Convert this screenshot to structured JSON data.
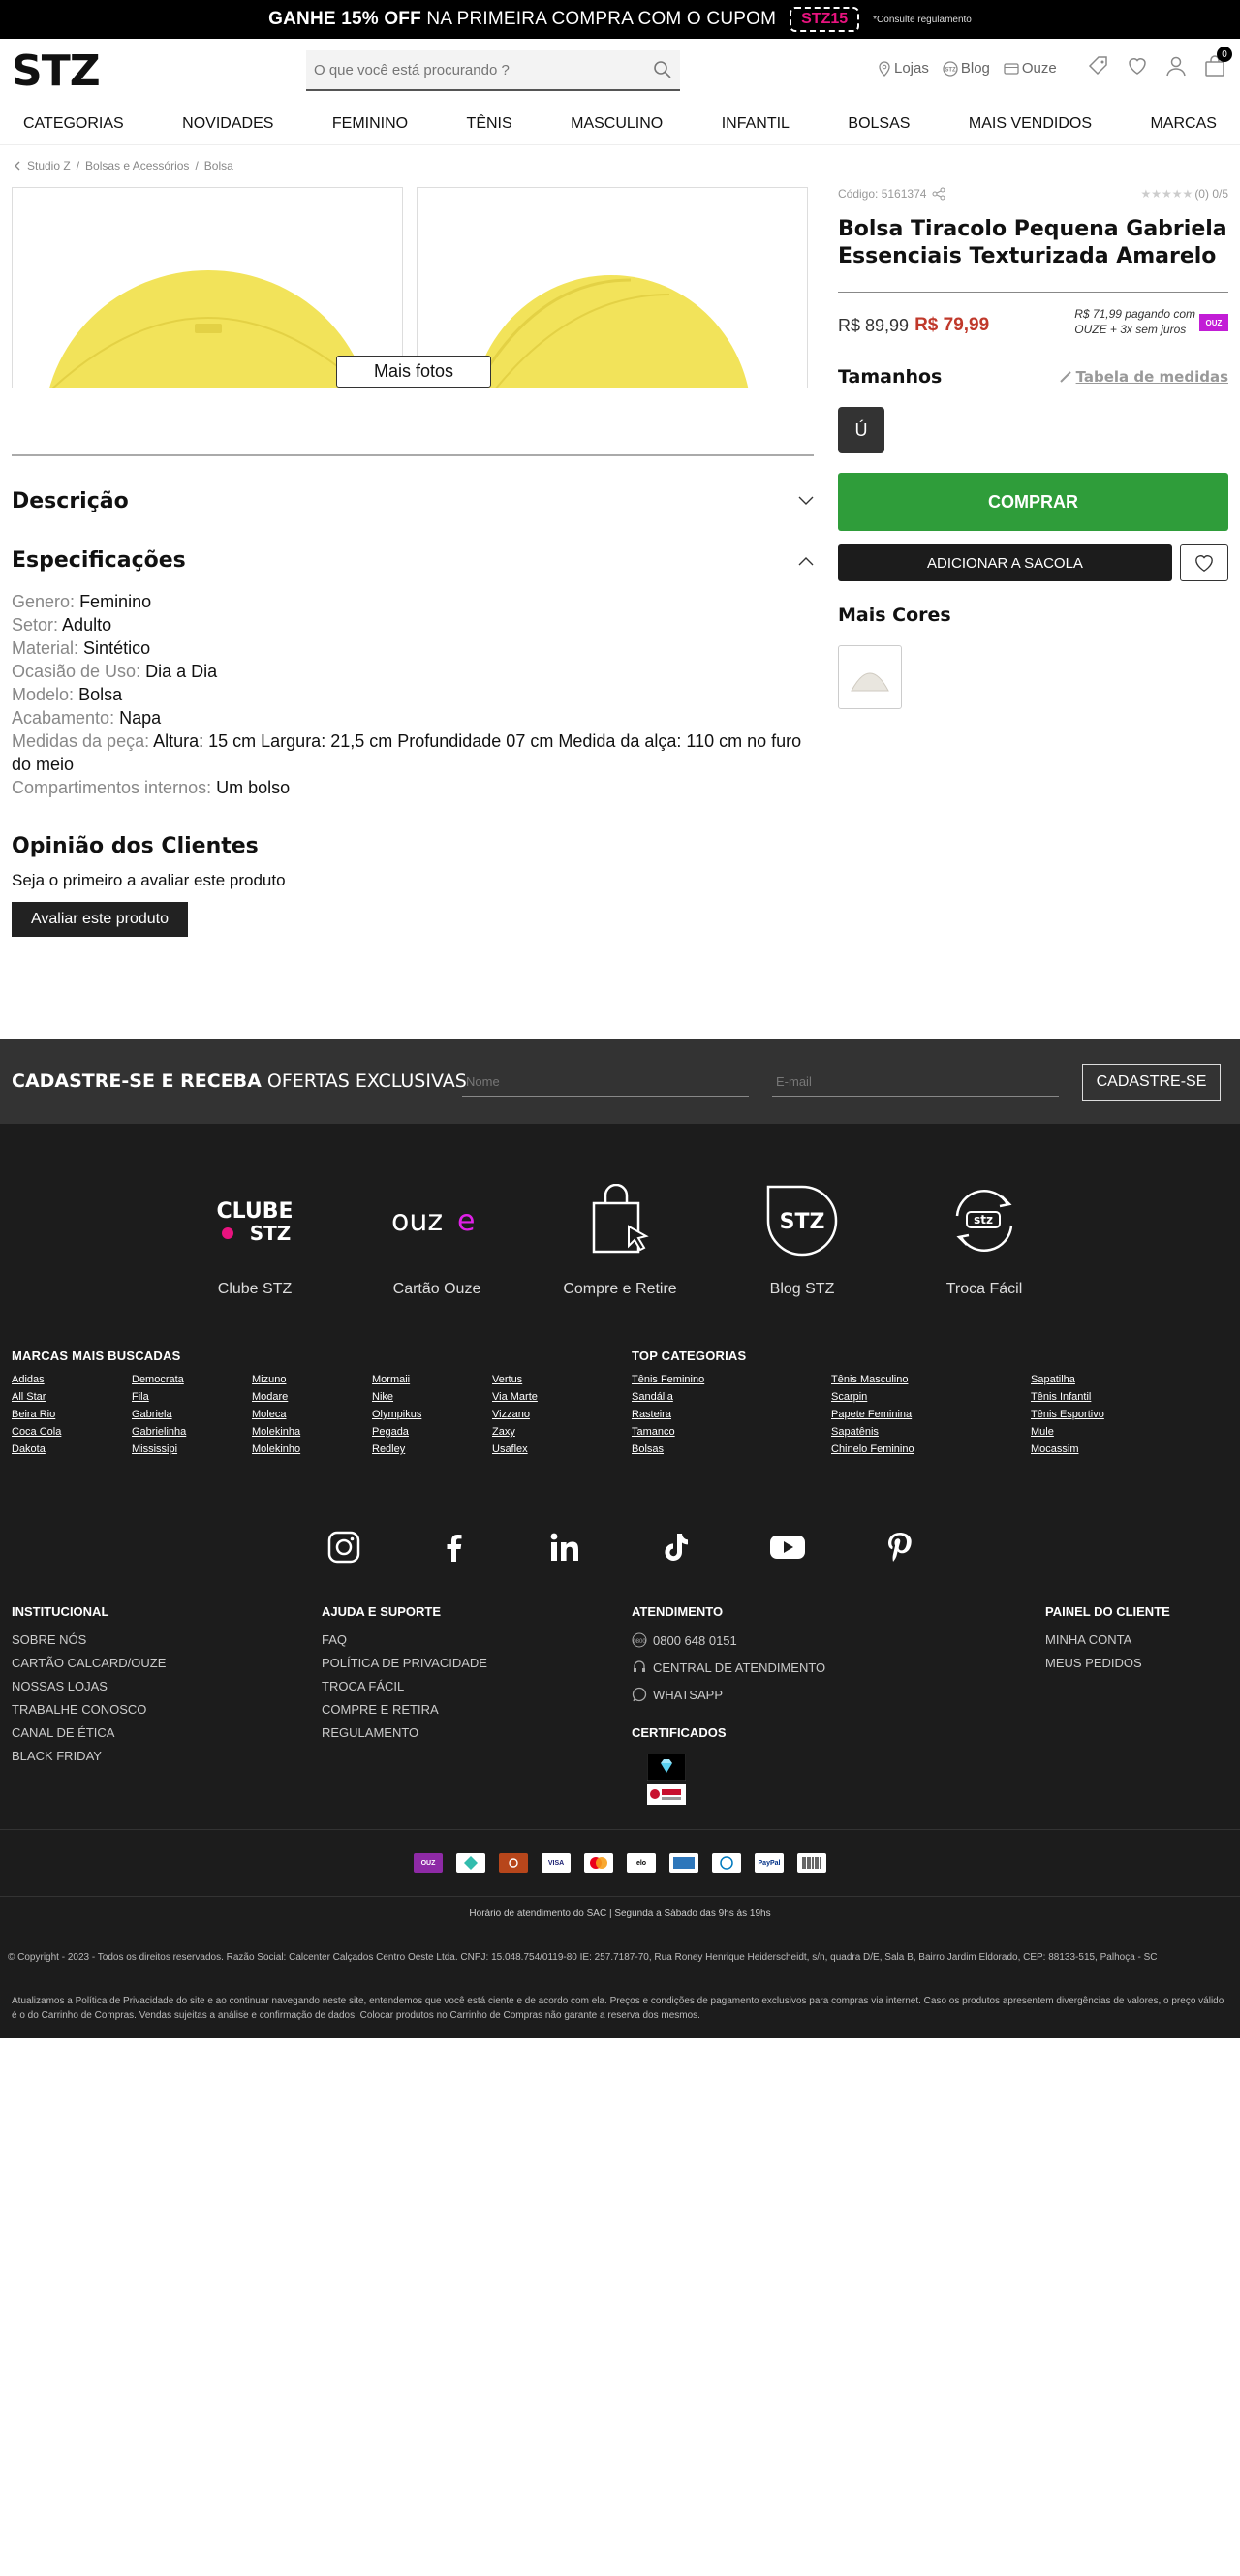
{
  "topbar": {
    "promo_bold": "GANHE 15% OFF",
    "promo_rest": "NA PRIMEIRA COMPRA COM O CUPOM",
    "coupon": "STZ15",
    "note": "*Consulte regulamento"
  },
  "header": {
    "logo": "STZ",
    "search_placeholder": "O que você está procurando ?",
    "links": [
      "Lojas",
      "Blog",
      "Ouze"
    ],
    "cart_count": "0"
  },
  "nav": [
    "CATEGORIAS",
    "NOVIDADES",
    "FEMININO",
    "TÊNIS",
    "MASCULINO",
    "INFANTIL",
    "BOLSAS",
    "MAIS VENDIDOS",
    "MARCAS"
  ],
  "breadcrumb": [
    "Studio Z",
    "Bolsas e Acessórios",
    "Bolsa"
  ],
  "gallery": {
    "more_photos": "Mais fotos"
  },
  "sections": {
    "description": "Descrição",
    "specifications": "Especificações",
    "reviews": "Opinião dos Clientes",
    "reviews_sub": "Seja o primeiro a avaliar este produto",
    "review_button": "Avaliar este produto"
  },
  "specs": [
    {
      "k": "Genero:",
      "v": "Feminino"
    },
    {
      "k": "Setor:",
      "v": "Adulto"
    },
    {
      "k": "Material:",
      "v": "Sintético"
    },
    {
      "k": "Ocasião de Uso:",
      "v": "Dia a Dia"
    },
    {
      "k": "Modelo:",
      "v": "Bolsa"
    },
    {
      "k": "Acabamento:",
      "v": "Napa"
    },
    {
      "k": "Medidas da peça:",
      "v": "Altura: 15 cm Largura: 21,5 cm Profundidade 07 cm Medida da alça: 110 cm no furo do meio"
    },
    {
      "k": "Compartimentos internos:",
      "v": "Um bolso"
    }
  ],
  "product": {
    "code": "Código: 5161374",
    "rating": "(0) 0/5",
    "title": "Bolsa Tiracolo Pequena Gabriela Essenciais Texturizada Amarelo",
    "old_price": "R$ 89,99",
    "price": "R$ 79,99",
    "installment_1": "R$ 71,99 pagando com",
    "installment_2": "OUZE + 3x sem juros",
    "ouze_badge": "OUZ",
    "sizes_label": "Tamanhos",
    "size_table": "Tabela de medidas",
    "size_value": "Ú",
    "buy": "COMPRAR",
    "add_bag": "ADICIONAR A SACOLA",
    "more_colors": "Mais Cores"
  },
  "colors": {
    "bag_yellow": "#f2e35a",
    "bag_yellow_dark": "#e3d145",
    "buy_green": "#2f9d3a",
    "price_red": "#c0392b",
    "ouze_pink": "#c21dd6"
  },
  "signup": {
    "title_bold": "CADASTRE-SE E RECEBA",
    "title_rest": "OFERTAS EXCLUSIVAS",
    "name_placeholder": "Nome",
    "email_placeholder": "E-mail",
    "button": "CADASTRE-SE"
  },
  "footer_features": [
    {
      "label": "Clube STZ",
      "icon": "clube-stz-logo"
    },
    {
      "label": "Cartão Ouze",
      "icon": "ouze-logo"
    },
    {
      "label": "Compre e Retire",
      "icon": "shopping-bag-icon"
    },
    {
      "label": "Blog STZ",
      "icon": "stz-circle-logo"
    },
    {
      "label": "Troca Fácil",
      "icon": "exchange-icon"
    }
  ],
  "brands_title": "MARCAS MAIS BUSCADAS",
  "brands": [
    "Adidas",
    "Democrata",
    "Mizuno",
    "Mormaii",
    "Vertus",
    "All Star",
    "Fila",
    "Modare",
    "Nike",
    "Via Marte",
    "Beira Rio",
    "Gabriela",
    "Moleca",
    "Olympikus",
    "Vizzano",
    "Coca Cola",
    "Gabrielinha",
    "Molekinha",
    "Pegada",
    "Zaxy",
    "Dakota",
    "Mississipi",
    "Molekinho",
    "Redley",
    "Usaflex"
  ],
  "cats_title": "TOP CATEGORIAS",
  "cats": [
    "Tênis Feminino",
    "Tênis Masculino",
    "Sapatilha",
    "Sandália",
    "Scarpin",
    "Tênis Infantil",
    "Rasteira",
    "Papete Feminina",
    "Tênis Esportivo",
    "Tamanco",
    "Sapatênis",
    "Mule",
    "Bolsas",
    "Chinelo Feminino",
    "Mocassim"
  ],
  "social": [
    "instagram-icon",
    "facebook-icon",
    "linkedin-icon",
    "tiktok-icon",
    "youtube-icon",
    "pinterest-icon"
  ],
  "footer_cols": {
    "inst_title": "INSTITUCIONAL",
    "inst": [
      "SOBRE NÓS",
      "CARTÃO CALCARD/OUZE",
      "NOSSAS LOJAS",
      "TRABALHE CONOSCO",
      "CANAL DE ÉTICA",
      "BLACK FRIDAY"
    ],
    "help_title": "AJUDA E SUPORTE",
    "help": [
      "FAQ",
      "POLÍTICA DE PRIVACIDADE",
      "TROCA FÁCIL",
      "COMPRE E RETIRA",
      "REGULAMENTO"
    ],
    "att_title": "ATENDIMENTO",
    "att": [
      "0800 648 0151",
      "CENTRAL DE ATENDIMENTO",
      "WHATSAPP"
    ],
    "cert_title": "CERTIFICADOS",
    "panel_title": "PAINEL DO CLIENTE",
    "panel": [
      "MINHA CONTA",
      "MEUS PEDIDOS"
    ]
  },
  "payments": [
    "OUZ",
    "Pix",
    "Sorocred",
    "VISA",
    "Mastercard",
    "elo",
    "Amex",
    "Diners",
    "PayPal",
    "Boleto"
  ],
  "sac": "Horário de atendimento do SAC | Segunda a Sábado das 9hs às 19hs",
  "copyright": "© Copyright - 2023 - Todos os direitos reservados. Razão Social: Calcenter Calçados Centro Oeste Ltda. CNPJ: 15.048.754/0119-80 IE: 257.7187-70, Rua Roney Henrique Heiderscheidt, s/n, quadra D/E, Sala B, Bairro Jardim Eldorado, CEP: 88133-515, Palhoça - SC",
  "policy": "Atualizamos a Política de Privacidade do site e ao continuar navegando neste site, entendemos que você está ciente e de acordo com ela. Preços e condições de pagamento exclusivos para compras via internet. Caso os produtos apresentem divergências de valores, o preço válido é o do Carrinho de Compras. Vendas sujeitas a análise e confirmação de dados. Colocar produtos no Carrinho de Compras não garante a reserva dos mesmos."
}
